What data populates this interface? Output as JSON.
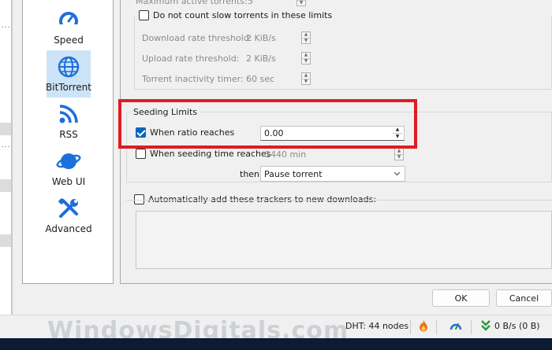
{
  "categories": [
    {
      "label": "Speed",
      "icon": "speed-gauge-icon",
      "selected": false
    },
    {
      "label": "BitTorrent",
      "icon": "globe-icon",
      "selected": true
    },
    {
      "label": "RSS",
      "icon": "rss-icon",
      "selected": false
    },
    {
      "label": "Web UI",
      "icon": "planet-icon",
      "selected": false
    },
    {
      "label": "Advanced",
      "icon": "tools-icon",
      "selected": false
    }
  ],
  "privacy": {
    "max_active_label": "Maximum active torrents:",
    "max_active_value": "5",
    "slow_torrents_label": "Do not count slow torrents in these limits",
    "download_threshold_label": "Download rate threshold:",
    "download_threshold_value": "2 KiB/s",
    "upload_threshold_label": "Upload rate threshold:",
    "upload_threshold_value": "2 KiB/s",
    "inactivity_label": "Torrent inactivity timer:",
    "inactivity_value": "60 sec"
  },
  "seeding": {
    "title": "Seeding Limits",
    "ratio_label": "When ratio reaches",
    "ratio_value": "0.00",
    "time_label": "When seeding time reaches",
    "time_value": "1440 min",
    "then_label": "then",
    "action_value": "Pause torrent"
  },
  "trackers": {
    "label": "Automatically add these trackers to new downloads:"
  },
  "buttons": {
    "ok": "OK",
    "cancel": "Cancel"
  },
  "status": {
    "dht": "DHT: 44 nodes",
    "speed": "0 B/s (0 B)"
  },
  "watermark": "WindowsDigitals.com",
  "colors": {
    "accent": "#0067c0",
    "highlight": "#e01b24",
    "selection": "#cce4f7"
  }
}
